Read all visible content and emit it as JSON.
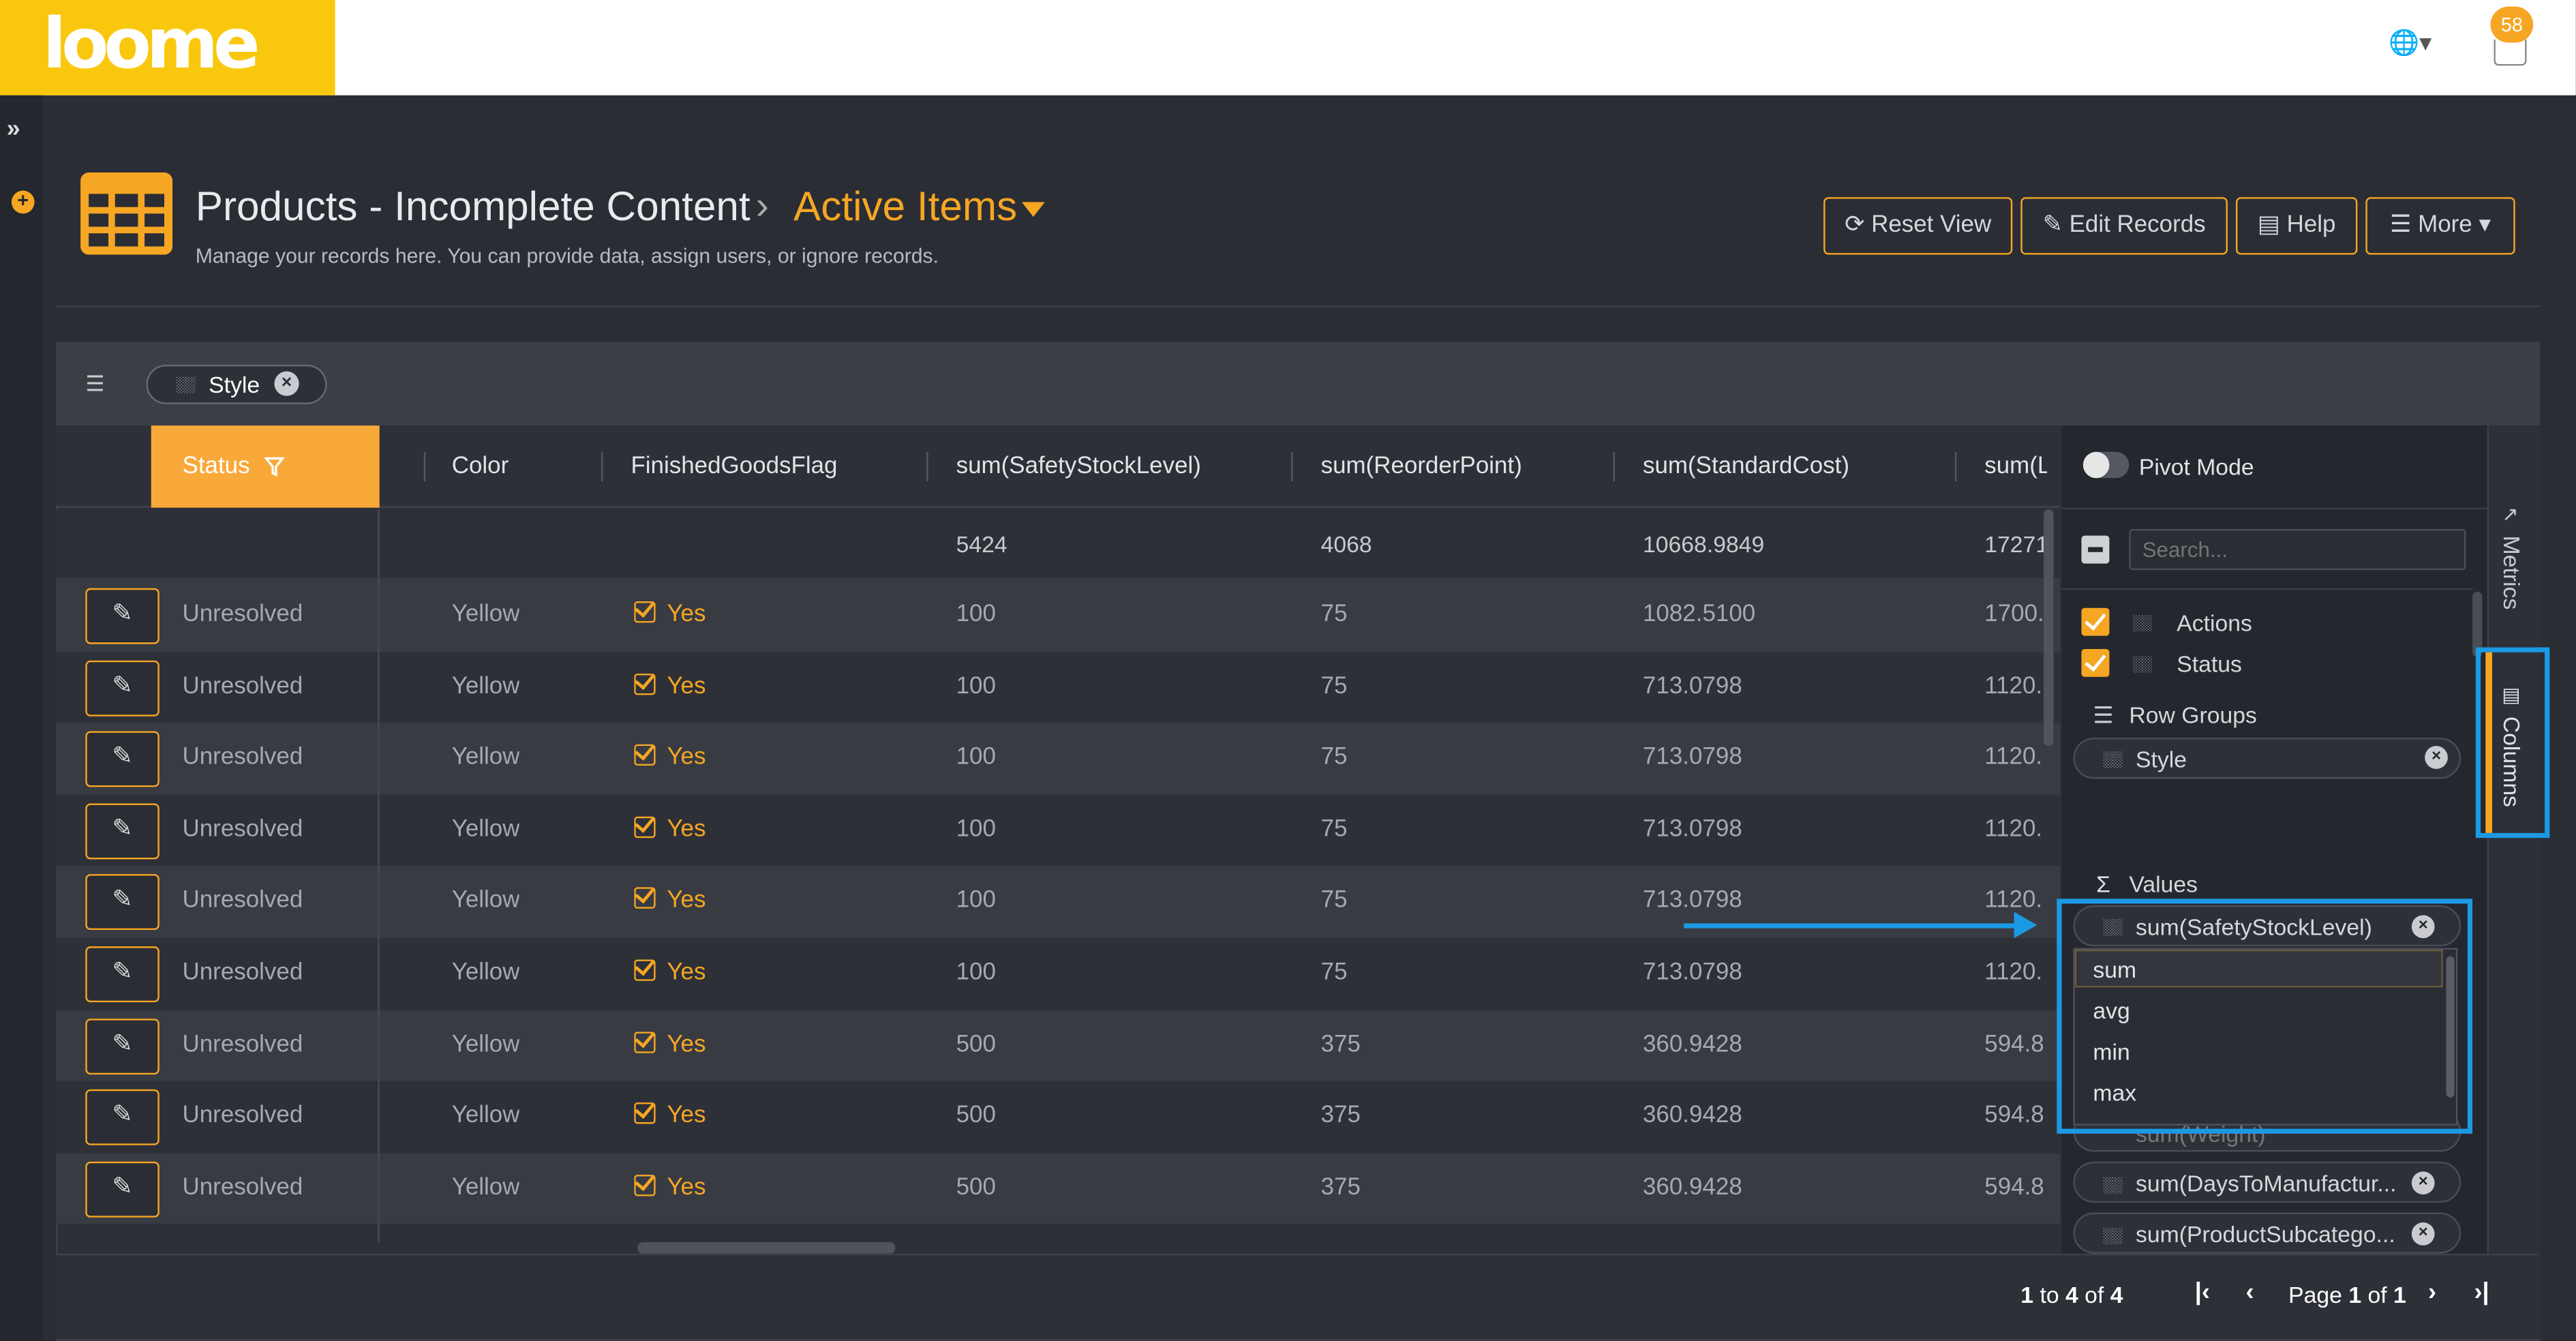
{
  "brand": {
    "logo_text": "loome",
    "accent": "#f5a623",
    "logo_bg": "#f9c80e",
    "highlight": "#1b9ae3"
  },
  "topbar": {
    "notification_count": "58"
  },
  "header": {
    "title": "Products - Incomplete Content",
    "view": "Active Items",
    "subtitle": "Manage your records here. You can provide data, assign users, or ignore records.",
    "buttons": {
      "reset": "Reset View",
      "edit": "Edit Records",
      "help": "Help",
      "more": "More"
    }
  },
  "grouping": {
    "chip": "Style"
  },
  "columns": {
    "status": "Status",
    "color": "Color",
    "finished": "FinishedGoodsFlag",
    "safety": "sum(SafetyStockLevel)",
    "reorder": "sum(ReorderPoint)",
    "cost": "sum(StandardCost)",
    "list": "sum(Li"
  },
  "totals": {
    "safety": "5424",
    "reorder": "4068",
    "cost": "10668.9849",
    "list": "17271"
  },
  "rows": [
    {
      "status": "Unresolved",
      "color": "Yellow",
      "finished": "Yes",
      "safety": "100",
      "reorder": "75",
      "cost": "1082.5100",
      "list": "1700."
    },
    {
      "status": "Unresolved",
      "color": "Yellow",
      "finished": "Yes",
      "safety": "100",
      "reorder": "75",
      "cost": "713.0798",
      "list": "1120."
    },
    {
      "status": "Unresolved",
      "color": "Yellow",
      "finished": "Yes",
      "safety": "100",
      "reorder": "75",
      "cost": "713.0798",
      "list": "1120."
    },
    {
      "status": "Unresolved",
      "color": "Yellow",
      "finished": "Yes",
      "safety": "100",
      "reorder": "75",
      "cost": "713.0798",
      "list": "1120."
    },
    {
      "status": "Unresolved",
      "color": "Yellow",
      "finished": "Yes",
      "safety": "100",
      "reorder": "75",
      "cost": "713.0798",
      "list": "1120."
    },
    {
      "status": "Unresolved",
      "color": "Yellow",
      "finished": "Yes",
      "safety": "100",
      "reorder": "75",
      "cost": "713.0798",
      "list": "1120."
    },
    {
      "status": "Unresolved",
      "color": "Yellow",
      "finished": "Yes",
      "safety": "500",
      "reorder": "375",
      "cost": "360.9428",
      "list": "594.8"
    },
    {
      "status": "Unresolved",
      "color": "Yellow",
      "finished": "Yes",
      "safety": "500",
      "reorder": "375",
      "cost": "360.9428",
      "list": "594.8"
    },
    {
      "status": "Unresolved",
      "color": "Yellow",
      "finished": "Yes",
      "safety": "500",
      "reorder": "375",
      "cost": "360.9428",
      "list": "594.8"
    }
  ],
  "tool_panel": {
    "pivot_mode": "Pivot Mode",
    "search_placeholder": "Search...",
    "column_items": [
      "Actions",
      "Status"
    ],
    "row_groups_label": "Row Groups",
    "row_group_chip": "Style",
    "values_label": "Values",
    "value_chips": [
      "sum(SafetyStockLevel)",
      "sum(Weight)",
      "sum(DaysToManufactur...",
      "sum(ProductSubcatego..."
    ],
    "agg_options": [
      "sum",
      "avg",
      "min",
      "max"
    ],
    "tabs": {
      "metrics": "Metrics",
      "columns": "Columns"
    }
  },
  "footer": {
    "range_from": "1",
    "range_to": "4",
    "range_total": "4",
    "page_current": "1",
    "page_total": "1"
  }
}
